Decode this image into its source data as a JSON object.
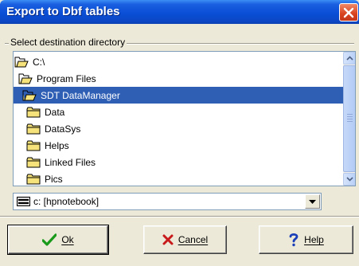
{
  "window": {
    "title": "Export to Dbf tables"
  },
  "group": {
    "label": "Select destination directory"
  },
  "directories": [
    {
      "label": "C:\\",
      "icon": "open-folder-icon",
      "selected": false
    },
    {
      "label": "Program Files",
      "icon": "open-folder-icon",
      "selected": false
    },
    {
      "label": "SDT DataManager",
      "icon": "open-folder-icon",
      "selected": true
    },
    {
      "label": "Data",
      "icon": "folder-icon",
      "selected": false
    },
    {
      "label": "DataSys",
      "icon": "folder-icon",
      "selected": false
    },
    {
      "label": "Helps",
      "icon": "folder-icon",
      "selected": false
    },
    {
      "label": "Linked Files",
      "icon": "folder-icon",
      "selected": false
    },
    {
      "label": "Pics",
      "icon": "folder-icon",
      "selected": false
    }
  ],
  "drive": {
    "value": "c: [hpnotebook]"
  },
  "buttons": {
    "ok": "Ok",
    "cancel": "Cancel",
    "help": "Help"
  },
  "colors": {
    "selection": "#2f5fb5",
    "titlebar": "#0a4fd6"
  }
}
